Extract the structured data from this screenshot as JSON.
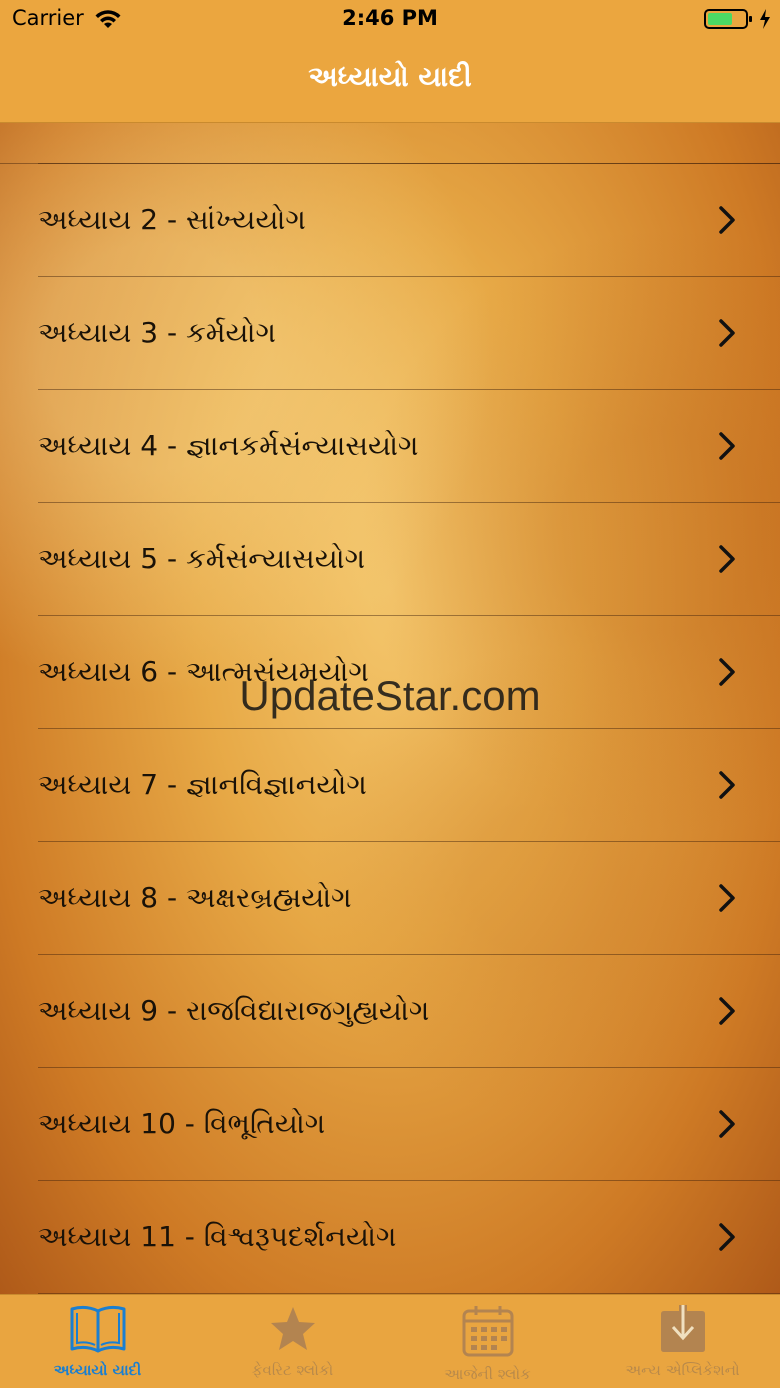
{
  "status": {
    "carrier": "Carrier",
    "time": "2:46 PM"
  },
  "nav": {
    "title": "અધ્યાયો યાદી"
  },
  "chapters": [
    "અધ્યાય 2 - સાંખ્યયોગ",
    "અધ્યાય 3 - કર્મયોગ",
    "અધ્યાય 4 - જ્ઞાનકર્મસંન્યાસયોગ",
    "અધ્યાય 5 - કર્મસંન્યાસયોગ",
    "અધ્યાય 6 - આત્મસંયમયોગ",
    "અધ્યાય 7 - જ્ઞાનવિજ્ઞાનયોગ",
    "અધ્યાય 8 - અક્ષરબ્રહ્મયોગ",
    "અધ્યાય 9 - રાજવિદ્યારાજગુહ્યયોગ",
    "અધ્યાય 10 - વિભૂતિયોગ",
    "અધ્યાય 11 - વિશ્વરૂપદર્શનયોગ"
  ],
  "watermark": "UpdateStar.com",
  "tabs": [
    {
      "label": "અધ્યાયો યાદી",
      "icon": "book-icon",
      "active": true
    },
    {
      "label": "ફેવરિટ શ્લોકો",
      "icon": "star-icon",
      "active": false
    },
    {
      "label": "આજેની શ્લોક",
      "icon": "calendar-icon",
      "active": false
    },
    {
      "label": "અન્ય એપ્લિકેશનો",
      "icon": "download-icon",
      "active": false
    }
  ],
  "colors": {
    "nav_bg": "#eba63f",
    "active_tab": "#1a7fd1",
    "inactive_tab": "#b8894a",
    "battery": "#4cd964"
  }
}
